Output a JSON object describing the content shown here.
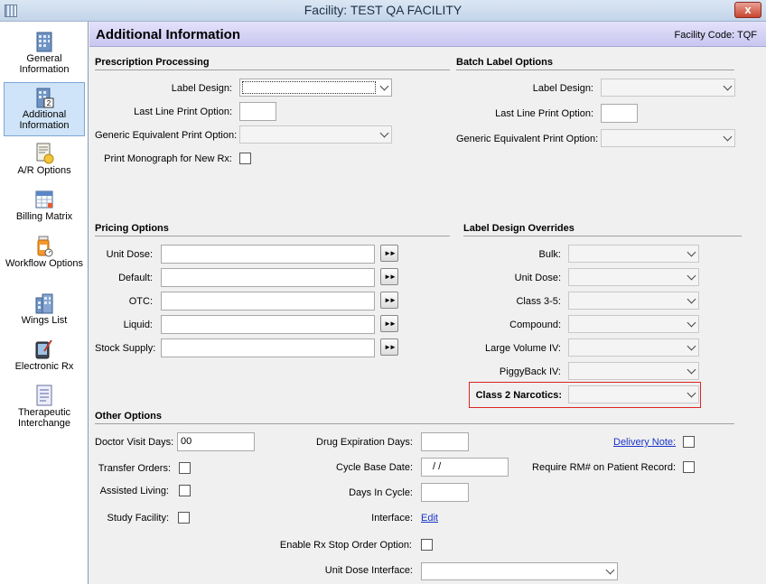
{
  "window": {
    "title": "Facility: TEST QA FACILITY",
    "close": "x"
  },
  "sidebar": {
    "items": [
      {
        "label": "General Information"
      },
      {
        "label": "Additional Information"
      },
      {
        "label": "A/R Options"
      },
      {
        "label": "Billing Matrix"
      },
      {
        "label": "Workflow Options"
      },
      {
        "label": "Wings List"
      },
      {
        "label": "Electronic Rx"
      },
      {
        "label": "Therapeutic Interchange"
      }
    ]
  },
  "header": {
    "title": "Additional Information",
    "facility_code": "Facility Code:  TQF"
  },
  "prescription": {
    "heading": "Prescription Processing",
    "label_design": "Label Design:",
    "last_line": "Last Line Print Option:",
    "generic": "Generic Equivalent Print Option:",
    "monograph": "Print Monograph for New Rx:"
  },
  "batch": {
    "heading": "Batch Label Options",
    "label_design": "Label Design:",
    "last_line": "Last Line Print Option:",
    "generic": "Generic Equivalent Print Option:"
  },
  "pricing": {
    "heading": "Pricing Options",
    "rows": [
      "Unit Dose:",
      "Default:",
      "OTC:",
      "Liquid:",
      "Stock Supply:"
    ],
    "btn": "►►"
  },
  "overrides": {
    "heading": "Label Design Overrides",
    "rows": [
      "Bulk:",
      "Unit Dose:",
      "Class 3-5:",
      "Compound:",
      "Large Volume IV:",
      "PiggyBack IV:"
    ],
    "narcotics": "Class 2 Narcotics:"
  },
  "other": {
    "heading": "Other Options",
    "doctor_visit": "Doctor Visit Days:",
    "doctor_visit_value": "00",
    "transfer": "Transfer Orders:",
    "assisted": "Assisted Living:",
    "study": "Study Facility:",
    "drug_exp": "Drug Expiration Days:",
    "cycle_base": "Cycle Base Date:",
    "cycle_base_value": "/ /",
    "days_cycle": "Days In Cycle:",
    "interface": "Interface:",
    "interface_link": "Edit",
    "stop_order": "Enable Rx Stop Order Option:",
    "unit_dose_interface": "Unit Dose Interface:",
    "delivery_note": "Delivery Note:",
    "require_rm": "Require RM# on Patient Record:"
  }
}
